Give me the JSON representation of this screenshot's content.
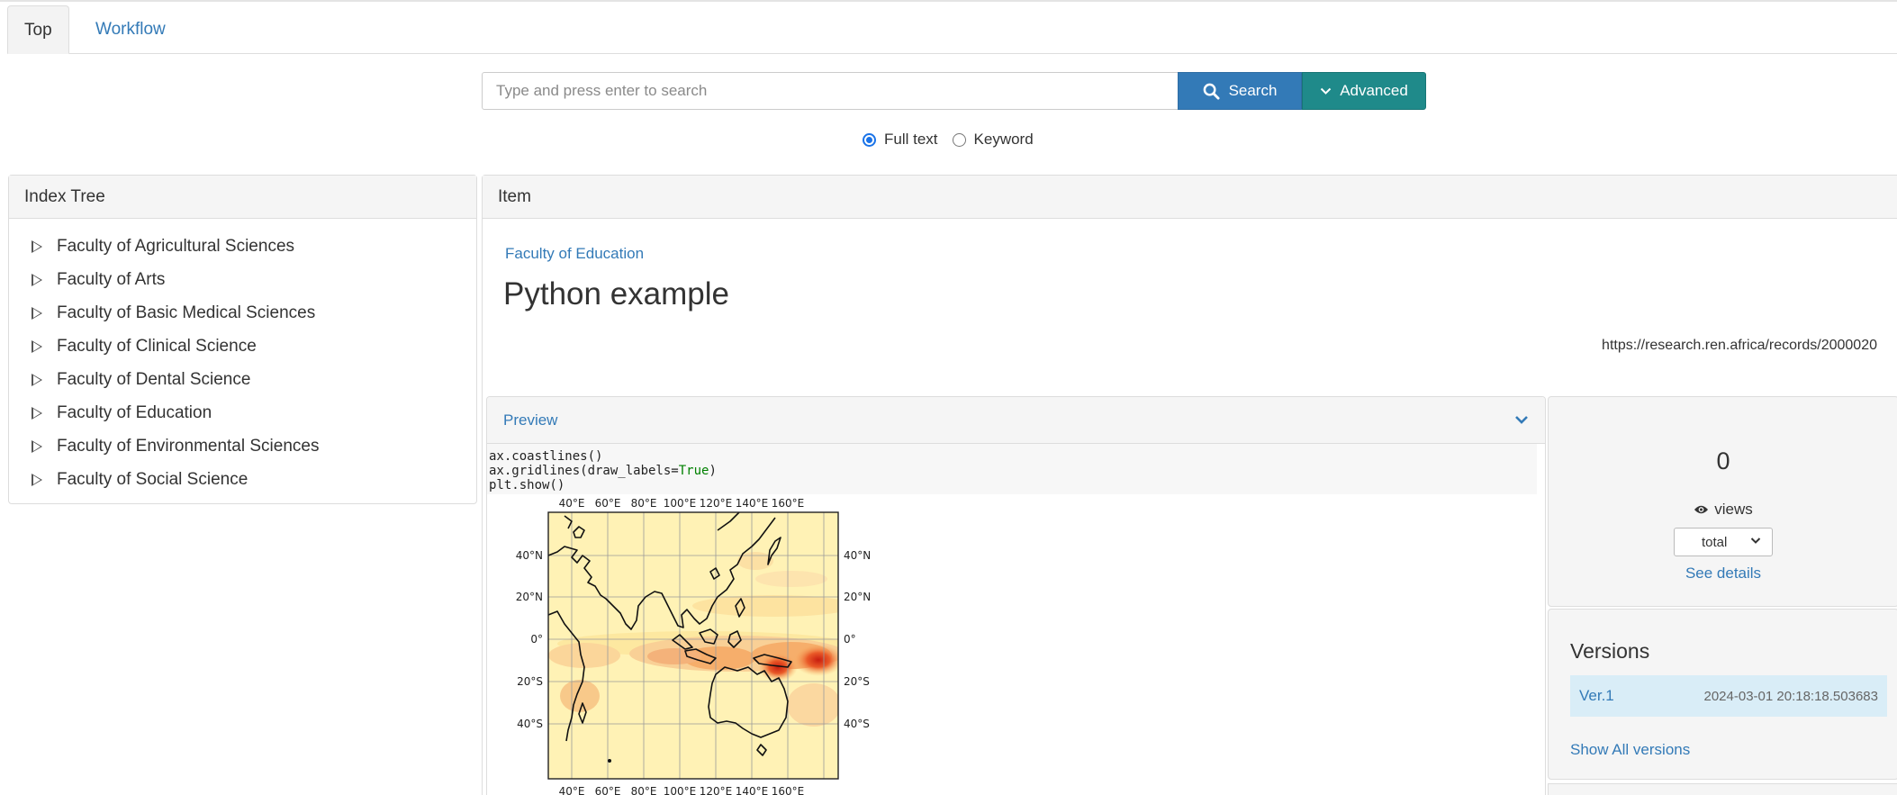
{
  "tabs": [
    {
      "label": "Top",
      "active": true
    },
    {
      "label": "Workflow",
      "active": false
    }
  ],
  "search": {
    "placeholder": "Type and press enter to search",
    "search_label": "Search",
    "advanced_label": "Advanced",
    "options": [
      {
        "label": "Full text",
        "selected": true
      },
      {
        "label": "Keyword",
        "selected": false
      }
    ]
  },
  "index_tree": {
    "title": "Index Tree",
    "items": [
      "Faculty of Agricultural Sciences",
      "Faculty of Arts",
      "Faculty of Basic Medical Sciences",
      "Faculty of Clinical Science",
      "Faculty of Dental Science",
      "Faculty of Education",
      "Faculty of Environmental Sciences",
      "Faculty of Social Science"
    ]
  },
  "item": {
    "header": "Item",
    "breadcrumb": "Faculty of Education",
    "title": "Python example",
    "url": "https://research.ren.africa/records/2000020"
  },
  "preview": {
    "label": "Preview",
    "code_lines": [
      {
        "text": "ax.coastlines()"
      },
      {
        "text": "ax.gridlines(draw_labels=",
        "kw": "True",
        "end": ")"
      },
      {
        "text": "plt.show()"
      }
    ],
    "map": {
      "lon_labels": [
        "40°E",
        "60°E",
        "80°E",
        "100°E",
        "120°E",
        "140°E",
        "160°E"
      ],
      "lat_labels": [
        "40°N",
        "20°N",
        "0°",
        "20°S",
        "40°S"
      ]
    }
  },
  "stats": {
    "count": "0",
    "views_label": "views",
    "period": "total",
    "see_details": "See details"
  },
  "versions": {
    "title": "Versions",
    "rows": [
      {
        "name": "Ver.1",
        "date": "2024-03-01 20:18:18.503683"
      }
    ],
    "show_all": "Show All versions"
  },
  "colors": {
    "link": "#337ab7",
    "search_button": "#337ab7",
    "advanced_button": "#1f8a8a",
    "version_row": "#d9edf7"
  }
}
